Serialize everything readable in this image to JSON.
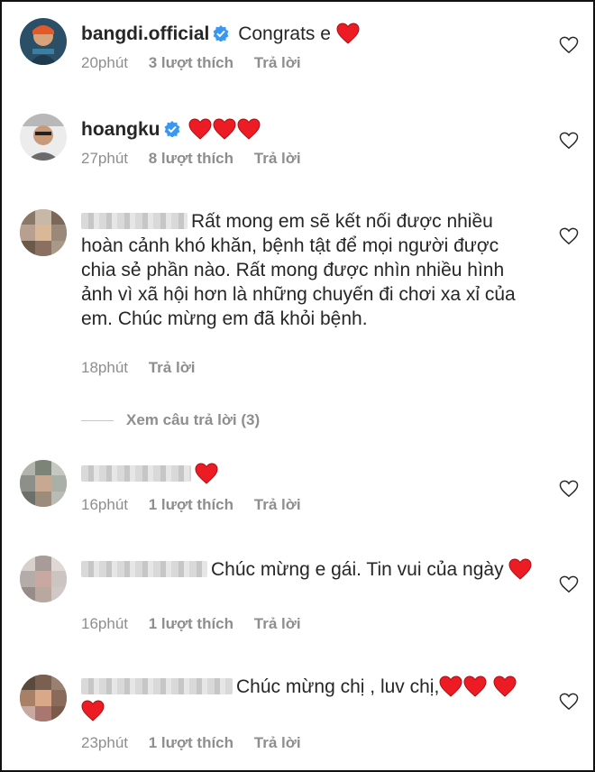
{
  "comments": [
    {
      "username": "bangdi.official",
      "verified": true,
      "text": "Congrats e",
      "hearts": 1,
      "time": "20phút",
      "likes": "3 lượt thích",
      "reply": "Trả lời"
    },
    {
      "username": "hoangku",
      "verified": true,
      "text": "",
      "hearts": 3,
      "time": "27phút",
      "likes": "8 lượt thích",
      "reply": "Trả lời"
    },
    {
      "username": "",
      "verified": false,
      "text": "Rất mong em sẽ kết nối được nhiều hoàn cảnh khó khăn, bệnh tật để mọi người được chia sẻ phần nào. Rất mong được nhìn nhiều hình ảnh vì xã hội hơn là những chuyến đi chơi xa xỉ của em. Chúc mừng em đã khỏi bệnh.",
      "hearts": 0,
      "time": "18phút",
      "likes": "",
      "reply": "Trả lời"
    },
    {
      "username": "",
      "verified": false,
      "text": "",
      "hearts": 1,
      "time": "16phút",
      "likes": "1 lượt thích",
      "reply": "Trả lời"
    },
    {
      "username": "",
      "verified": false,
      "text": "Chúc mừng e gái. Tin vui của ngày",
      "hearts": 1,
      "time": "16phút",
      "likes": "1 lượt thích",
      "reply": "Trả lời"
    },
    {
      "username": "",
      "verified": false,
      "text": "Chúc mừng chị , luv chị,",
      "hearts": 4,
      "time": "23phút",
      "likes": "1 lượt thích",
      "reply": "Trả lời"
    }
  ],
  "view_replies": "Xem câu trả lời (3)",
  "colors": {
    "heart": "#ed1c24",
    "verified": "#3897f0",
    "meta": "#8e8e8e"
  }
}
